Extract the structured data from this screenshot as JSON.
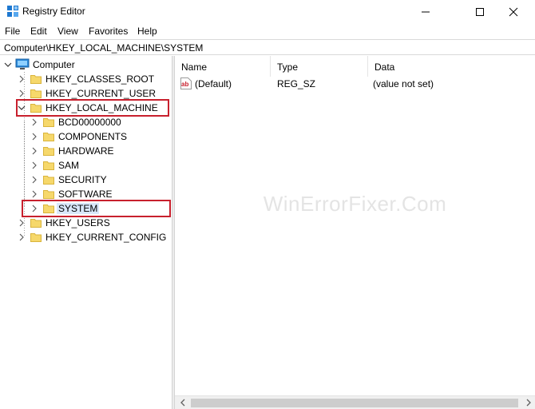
{
  "window": {
    "title": "Registry Editor"
  },
  "menu": [
    "File",
    "Edit",
    "View",
    "Favorites",
    "Help"
  ],
  "address": "Computer\\HKEY_LOCAL_MACHINE\\SYSTEM",
  "tree": {
    "root": "Computer",
    "hives": {
      "classes_root": "HKEY_CLASSES_ROOT",
      "current_user": "HKEY_CURRENT_USER",
      "local_machine": "HKEY_LOCAL_MACHINE",
      "users": "HKEY_USERS",
      "current_config": "HKEY_CURRENT_CONFIG"
    },
    "local_machine_children": [
      "BCD00000000",
      "COMPONENTS",
      "HARDWARE",
      "SAM",
      "SECURITY",
      "SOFTWARE",
      "SYSTEM"
    ],
    "selected": "SYSTEM"
  },
  "list": {
    "columns": [
      "Name",
      "Type",
      "Data"
    ],
    "rows": [
      {
        "name": "(Default)",
        "type": "REG_SZ",
        "data": "(value not set)"
      }
    ]
  },
  "watermark": "WinErrorFixer.Com",
  "colors": {
    "highlight_box": "#c8202d",
    "folder": "#f6d86b",
    "selection": "#d9e8fb"
  }
}
